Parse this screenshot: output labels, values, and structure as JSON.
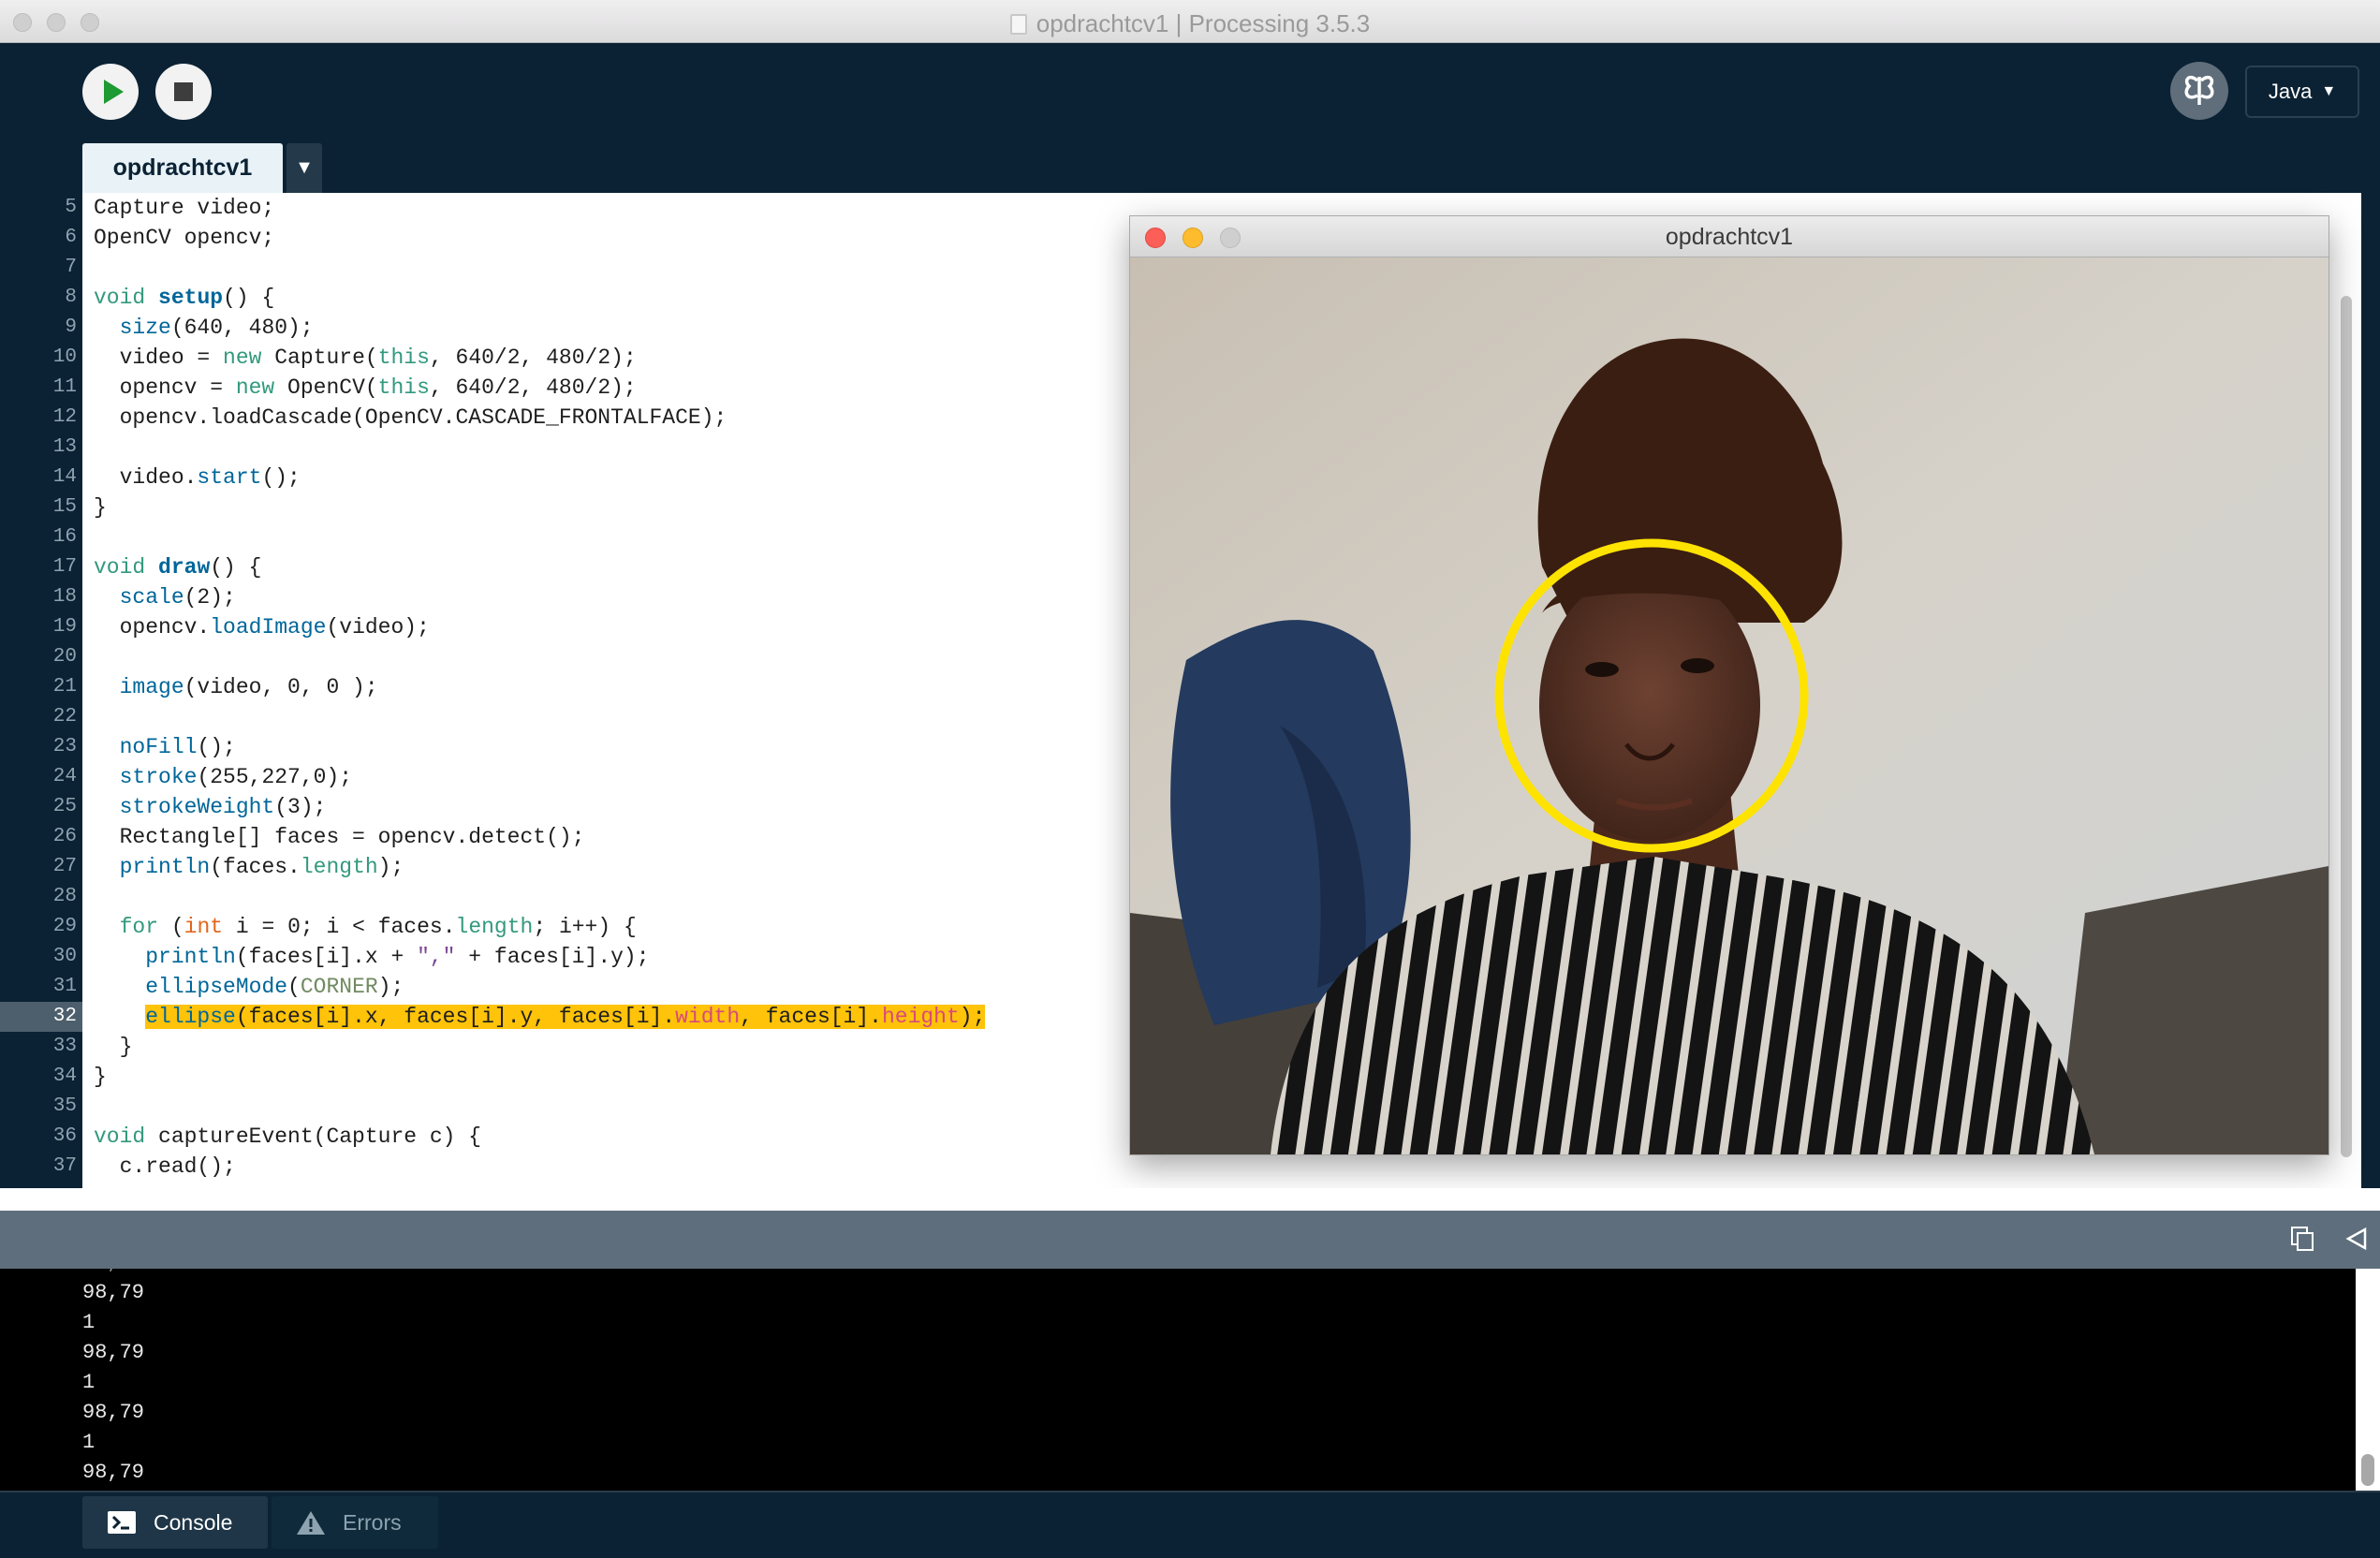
{
  "window": {
    "title": "opdrachtcv1 | Processing 3.5.3"
  },
  "toolbar": {
    "mode_label": "Java"
  },
  "tabs": [
    {
      "label": "opdrachtcv1"
    }
  ],
  "editor": {
    "line_numbers": [
      "5",
      "6",
      "7",
      "8",
      "9",
      "10",
      "11",
      "12",
      "13",
      "14",
      "15",
      "16",
      "17",
      "18",
      "19",
      "20",
      "21",
      "22",
      "23",
      "24",
      "25",
      "26",
      "27",
      "28",
      "29",
      "30",
      "31",
      "32",
      "33",
      "34",
      "35",
      "36",
      "37"
    ],
    "current_line": "32",
    "code": [
      "Capture video;",
      "OpenCV opencv;",
      "",
      "void setup() {",
      "  size(640, 480);",
      "  video = new Capture(this, 640/2, 480/2);",
      "  opencv = new OpenCV(this, 640/2, 480/2);",
      "  opencv.loadCascade(OpenCV.CASCADE_FRONTALFACE);",
      "",
      "  video.start();",
      "}",
      "",
      "void draw() {",
      "  scale(2);",
      "  opencv.loadImage(video);",
      "",
      "  image(video, 0, 0 );",
      "",
      "  noFill();",
      "  stroke(255,227,0);",
      "  strokeWeight(3);",
      "  Rectangle[] faces = opencv.detect();",
      "  println(faces.length);",
      "",
      "  for (int i = 0; i < faces.length; i++) {",
      "    println(faces[i].x + \",\" + faces[i].y);",
      "    ellipseMode(CORNER);",
      "    ellipse(faces[i].x, faces[i].y, faces[i].width, faces[i].height);",
      "  }",
      "}",
      "",
      "void captureEvent(Capture c) {",
      "  c.read();"
    ]
  },
  "sketch_window": {
    "title": "opdrachtcv1"
  },
  "console": {
    "lines": [
      "98,79",
      "1",
      "98,79",
      "1",
      "98,79",
      "1",
      "98,79"
    ]
  },
  "footer": {
    "console_label": "Console",
    "errors_label": "Errors"
  },
  "colors": {
    "editor_bg": "#ffffff",
    "chrome_bg": "#0b2234",
    "highlight": "#ffc30a",
    "face_circle": "#ffe300"
  }
}
